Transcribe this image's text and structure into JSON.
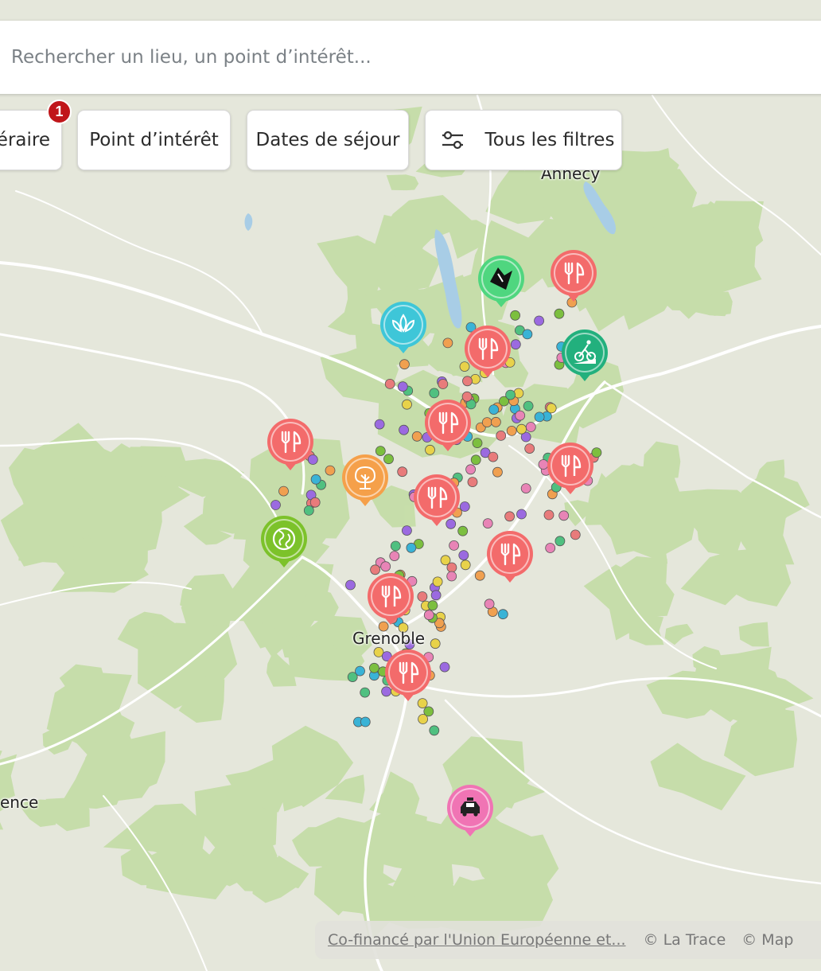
{
  "search": {
    "placeholder": "Rechercher un lieu, un point d’intérêt..."
  },
  "filters": {
    "items": [
      {
        "label": "éraire"
      },
      {
        "label": "Point d’intérêt"
      },
      {
        "label": "Dates de séjour"
      },
      {
        "label": "Tous les filtres",
        "icon": "sliders-icon"
      }
    ],
    "badge_count": "1"
  },
  "cities": [
    "Annecy",
    "Grenoble",
    "ence"
  ],
  "attribution": {
    "link": "Co-financé par l'Union Européenne et...",
    "credit1": "© La Trace",
    "credit2": "© Map"
  },
  "markers": [
    {
      "icon": "restaurant-icon",
      "color": "#f36b6b"
    },
    {
      "icon": "restaurant-icon",
      "color": "#f36b6b"
    },
    {
      "icon": "restaurant-icon",
      "color": "#f36b6b"
    },
    {
      "icon": "restaurant-icon",
      "color": "#f36b6b"
    },
    {
      "icon": "restaurant-icon",
      "color": "#f36b6b"
    },
    {
      "icon": "restaurant-icon",
      "color": "#f36b6b"
    },
    {
      "icon": "restaurant-icon",
      "color": "#f36b6b"
    },
    {
      "icon": "restaurant-icon",
      "color": "#f36b6b"
    },
    {
      "icon": "restaurant-icon",
      "color": "#f36b6b"
    },
    {
      "icon": "climbing-icon",
      "color": "#4fd67f"
    },
    {
      "icon": "lotus-icon",
      "color": "#3ec6d8"
    },
    {
      "icon": "mountain-bike-icon",
      "color": "#22b07d"
    },
    {
      "icon": "tree-icon",
      "color": "#f5a04a"
    },
    {
      "icon": "globe-icon",
      "color": "#7cc22a"
    },
    {
      "icon": "taxi-icon",
      "color": "#f074b4"
    }
  ],
  "colors": {
    "restaurant": "#f36b6b",
    "water": "#a6cce6",
    "forest": "#c4dca6",
    "land": "#e4e6da",
    "badge": "#c0161a"
  }
}
